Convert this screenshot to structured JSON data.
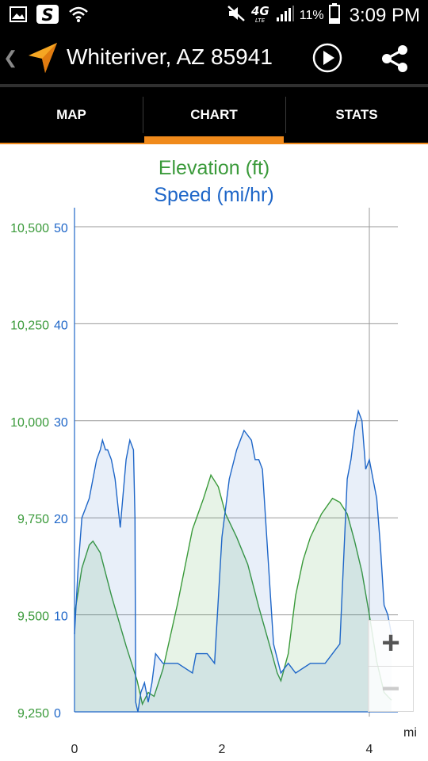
{
  "status_bar": {
    "battery_percent": "11%",
    "time": "3:09 PM",
    "network": "4G LTE",
    "icons": [
      "image-icon",
      "s-app-icon",
      "wifi-icon",
      "mute-icon",
      "signal-icon",
      "battery-icon"
    ]
  },
  "app_bar": {
    "title": "Whiteriver, AZ 85941",
    "icons": [
      "back-chevron-icon",
      "navigation-arrow-icon",
      "play-icon",
      "share-icon"
    ],
    "accent": "#f08a1c"
  },
  "tabs": [
    {
      "label": "MAP",
      "active": false
    },
    {
      "label": "CHART",
      "active": true
    },
    {
      "label": "STATS",
      "active": false
    }
  ],
  "chart": {
    "title_elevation": "Elevation (ft)",
    "title_speed": "Speed (mi/hr)",
    "x_unit": "mi"
  },
  "zoom": {
    "zoom_in": "+",
    "zoom_out": "−"
  },
  "chart_data": {
    "type": "area",
    "x_ticks": [
      "0",
      "2",
      "4"
    ],
    "xlim": [
      0,
      4.3
    ],
    "xlabel": "mi",
    "y_left_ticks": [
      "10,500",
      "10,250",
      "10,000",
      "9,750",
      "9,500",
      "9,250"
    ],
    "y_left_lim": [
      9250,
      10500
    ],
    "y_right_ticks": [
      "50",
      "40",
      "30",
      "20",
      "10",
      "0"
    ],
    "y_right_lim": [
      0,
      50
    ],
    "grid": true,
    "colors": {
      "elevation": "#3a9a3a",
      "speed": "#1e66c8"
    },
    "series": [
      {
        "axis": "left",
        "color": "#3a9a3a",
        "x": [
          0,
          0.1,
          0.2,
          0.25,
          0.35,
          0.5,
          0.7,
          0.85,
          0.92,
          1.0,
          1.08,
          1.2,
          1.4,
          1.6,
          1.75,
          1.85,
          1.95,
          2.05,
          2.2,
          2.35,
          2.5,
          2.65,
          2.75,
          2.8,
          2.9,
          3.0,
          3.1,
          3.2,
          3.35,
          3.5,
          3.6,
          3.7,
          3.8,
          3.9,
          4.0,
          4.1,
          4.2,
          4.3
        ],
        "values": [
          9500,
          9620,
          9680,
          9690,
          9660,
          9550,
          9420,
          9330,
          9270,
          9300,
          9290,
          9360,
          9530,
          9720,
          9800,
          9860,
          9830,
          9760,
          9700,
          9630,
          9520,
          9420,
          9350,
          9330,
          9400,
          9550,
          9640,
          9700,
          9760,
          9800,
          9790,
          9760,
          9690,
          9610,
          9500,
          9380,
          9300,
          9280
        ]
      },
      {
        "axis": "right",
        "color": "#1e66c8",
        "x": [
          0,
          0.05,
          0.1,
          0.15,
          0.2,
          0.3,
          0.35,
          0.38,
          0.42,
          0.45,
          0.5,
          0.55,
          0.62,
          0.7,
          0.75,
          0.8,
          0.82,
          0.83,
          0.86,
          0.9,
          0.95,
          1.0,
          1.05,
          1.1,
          1.2,
          1.4,
          1.6,
          1.65,
          1.8,
          1.9,
          2.0,
          2.1,
          2.2,
          2.3,
          2.4,
          2.45,
          2.5,
          2.55,
          2.7,
          2.8,
          2.9,
          3.0,
          3.2,
          3.4,
          3.5,
          3.6,
          3.7,
          3.75,
          3.8,
          3.85,
          3.9,
          3.95,
          4.0,
          4.05,
          4.1,
          4.15,
          4.2,
          4.25,
          4.3
        ],
        "values": [
          8,
          15,
          20,
          21,
          22,
          26,
          27,
          28,
          27,
          27,
          26,
          24,
          19,
          26,
          28,
          27,
          20,
          1,
          0,
          2,
          3,
          1,
          3,
          6,
          5,
          5,
          4,
          6,
          6,
          5,
          18,
          24,
          27,
          29,
          28,
          26,
          26,
          25,
          7,
          4,
          5,
          4,
          5,
          5,
          6,
          7,
          24,
          26,
          29,
          31,
          30,
          25,
          26,
          24,
          22,
          17,
          11,
          10,
          8
        ]
      }
    ]
  }
}
